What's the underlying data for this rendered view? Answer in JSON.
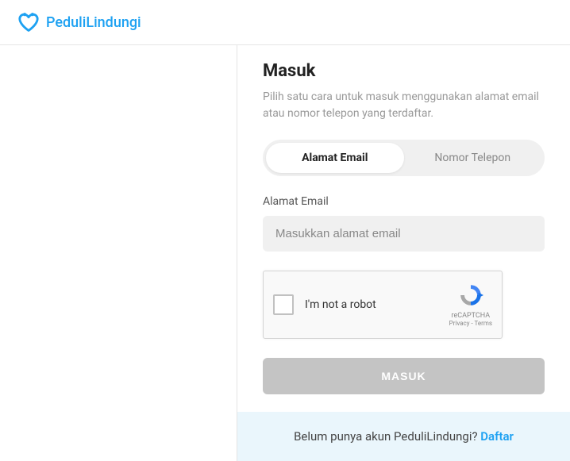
{
  "header": {
    "brand": "PeduliLindungi"
  },
  "login": {
    "title": "Masuk",
    "subtitle": "Pilih satu cara untuk masuk menggunakan alamat email atau nomor telepon yang terdaftar.",
    "tabs": {
      "email": "Alamat Email",
      "phone": "Nomor Telepon"
    },
    "email_label": "Alamat Email",
    "email_placeholder": "Masukkan alamat email",
    "submit_label": "MASUK"
  },
  "recaptcha": {
    "label": "I'm not a robot",
    "name": "reCAPTCHA",
    "links": "Privacy - Terms"
  },
  "footer": {
    "text": "Belum punya akun PeduliLindungi? ",
    "link": "Daftar"
  }
}
